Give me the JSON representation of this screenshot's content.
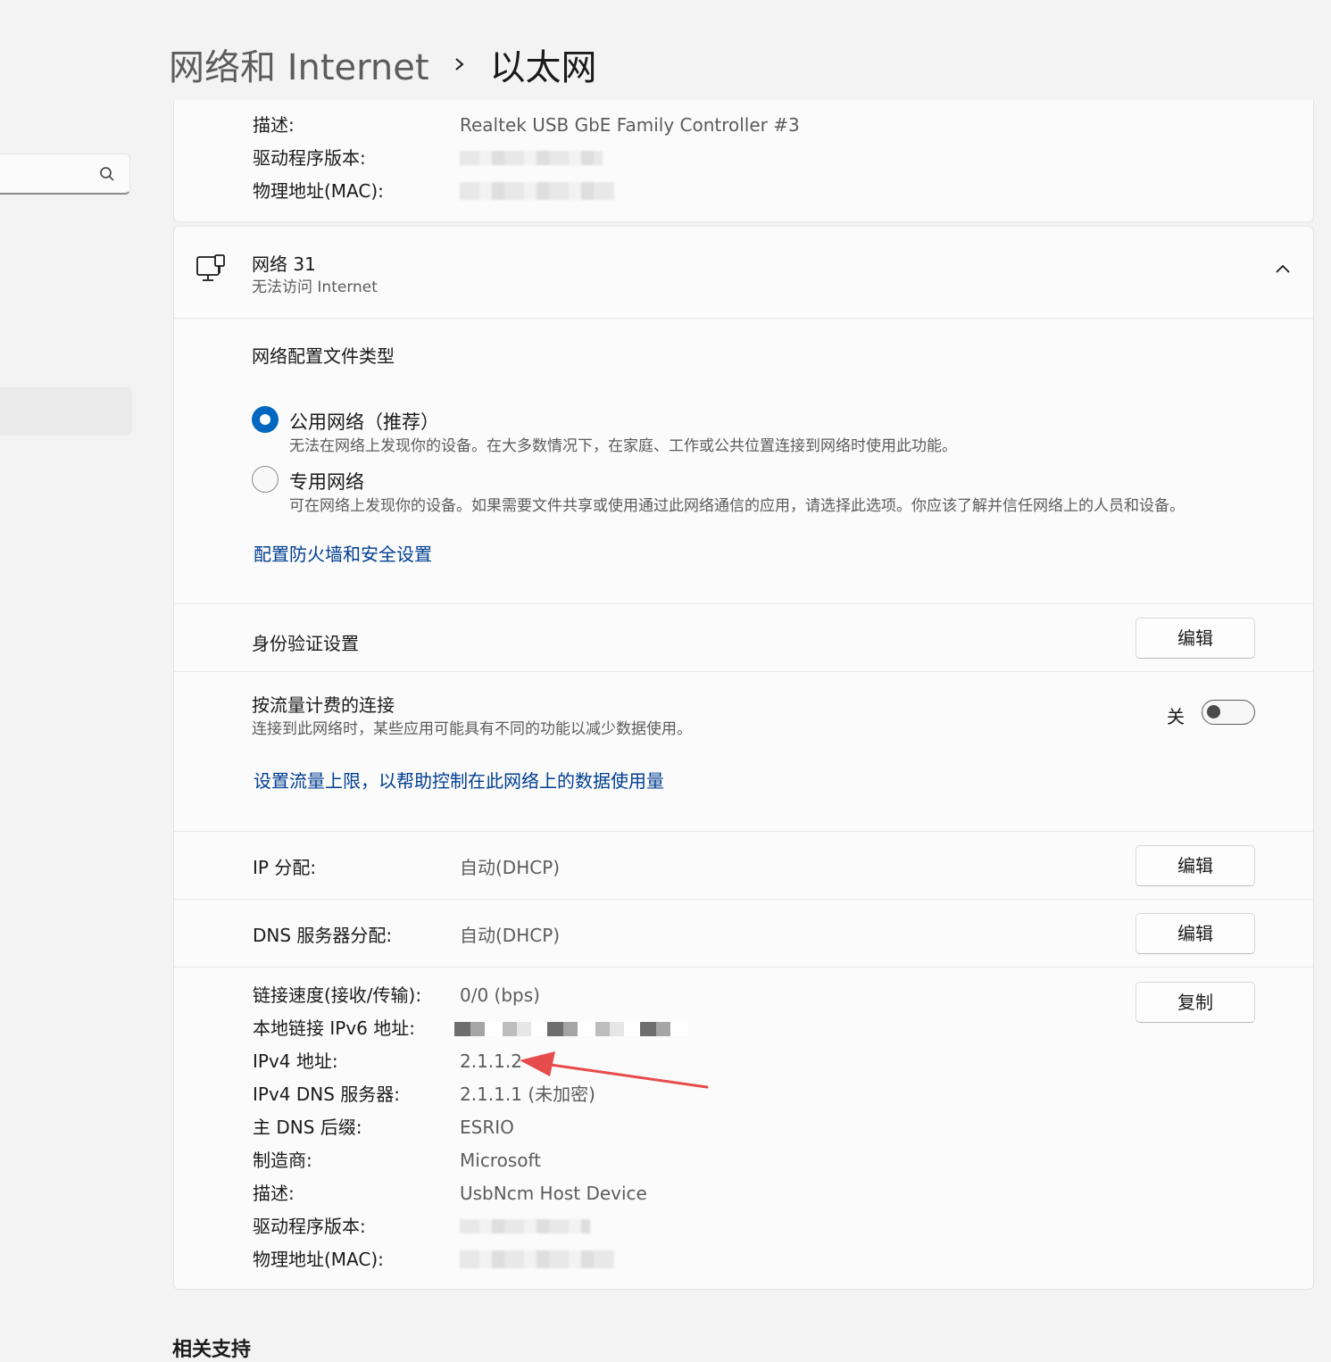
{
  "breadcrumb": {
    "parent": "网络和 Internet",
    "current": "以太网"
  },
  "top_card": {
    "rows": [
      {
        "key": "描述:",
        "value": "Realtek USB GbE Family Controller #3"
      },
      {
        "key": "驱动程序版本:",
        "value": ""
      },
      {
        "key": "物理地址(MAC):",
        "value": ""
      }
    ]
  },
  "network": {
    "name": "网络 31",
    "status": "无法访问 Internet",
    "profile_title": "网络配置文件类型",
    "public_label": "公用网络（推荐）",
    "public_desc": "无法在网络上发现你的设备。在大多数情况下，在家庭、工作或公共位置连接到网络时使用此功能。",
    "private_label": "专用网络",
    "private_desc": "可在网络上发现你的设备。如果需要文件共享或使用通过此网络通信的应用，请选择此选项。你应该了解并信任网络上的人员和设备。",
    "firewall_link": "配置防火墙和安全设置",
    "auth_label": "身份验证设置",
    "edit": "编辑",
    "metered_label": "按流量计费的连接",
    "metered_desc": "连接到此网络时，某些应用可能具有不同的功能以减少数据使用。",
    "toggle_state": "关",
    "data_limit_link": "设置流量上限，以帮助控制在此网络上的数据使用量",
    "ip_label": "IP 分配:",
    "ip_value": "自动(DHCP)",
    "dns_label": "DNS 服务器分配:",
    "dns_value": "自动(DHCP)",
    "copy": "复制",
    "details": [
      {
        "key": "链接速度(接收/传输):",
        "value": "0/0 (bps)"
      },
      {
        "key": "本地链接 IPv6 地址:",
        "value": ""
      },
      {
        "key": "IPv4 地址:",
        "value": "2.1.1.2"
      },
      {
        "key": "IPv4 DNS 服务器:",
        "value": "2.1.1.1 (未加密)"
      },
      {
        "key": "主 DNS 后缀:",
        "value": "ESRIO"
      },
      {
        "key": "制造商:",
        "value": "Microsoft"
      },
      {
        "key": "描述:",
        "value": "UsbNcm Host Device"
      },
      {
        "key": "驱动程序版本:",
        "value": ""
      },
      {
        "key": "物理地址(MAC):",
        "value": ""
      }
    ]
  },
  "related": "相关支持",
  "icons": {
    "search": "search-icon",
    "network": "ethernet-icon",
    "chevron": "chevron-up-icon",
    "breadcrumb_sep": "chevron-right-icon"
  },
  "colors": {
    "accent": "#0067c0",
    "link": "#003e92",
    "annotation_arrow": "#e74c4c"
  }
}
